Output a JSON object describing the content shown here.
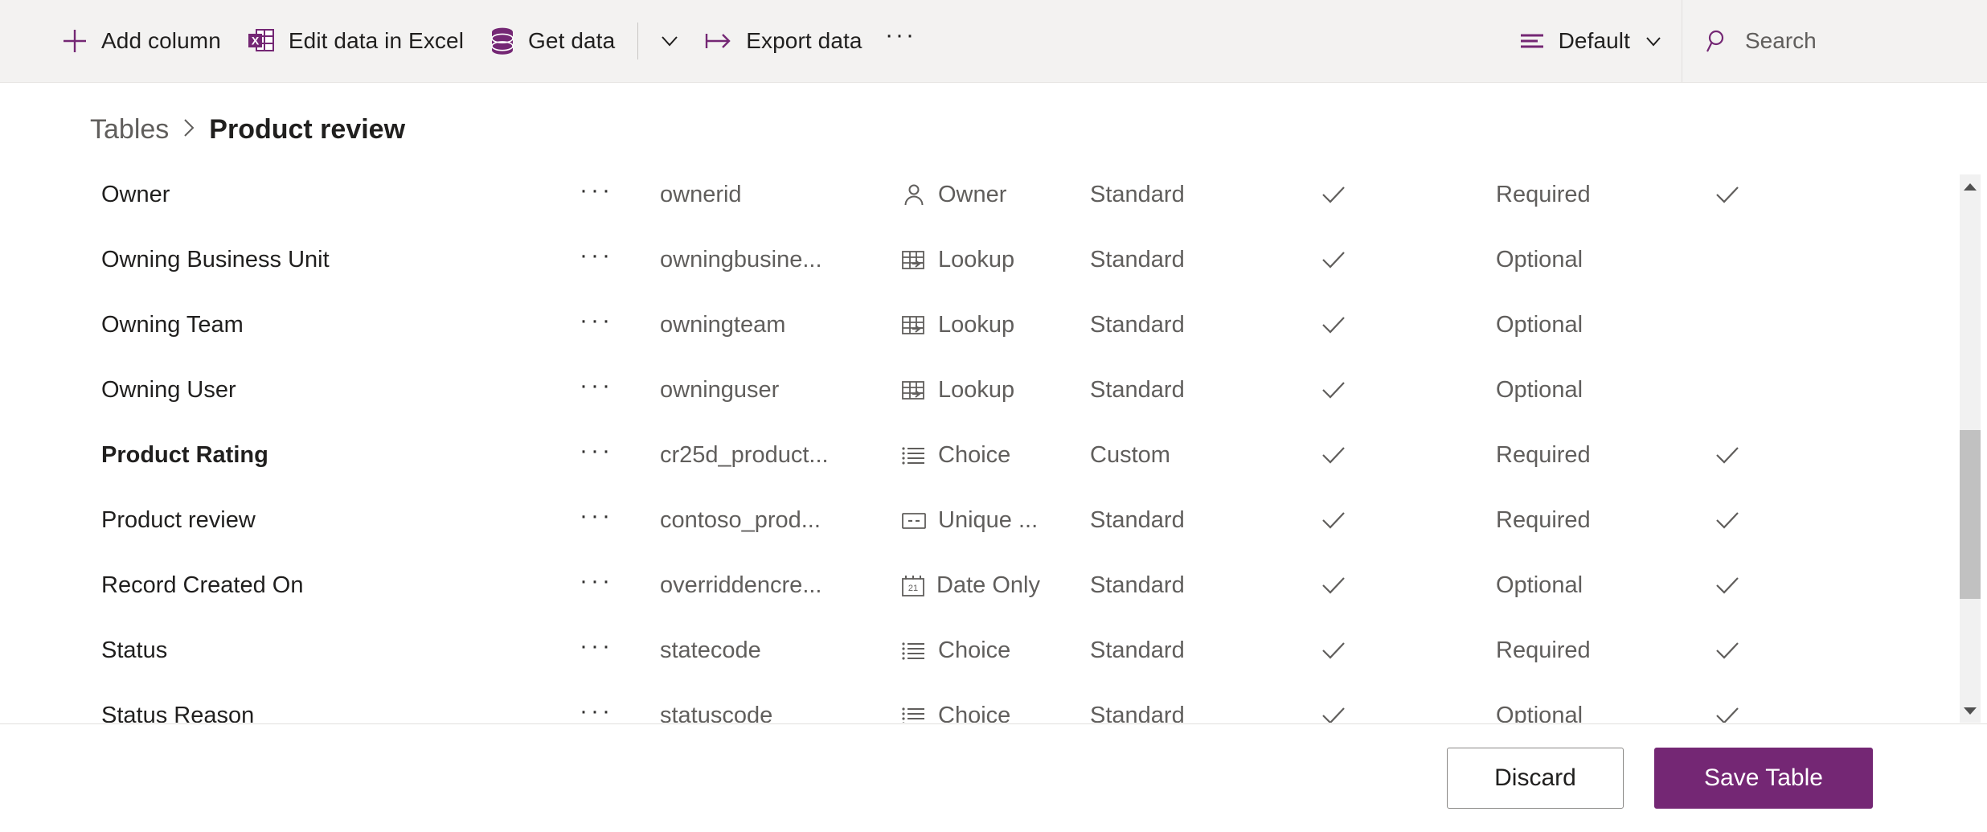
{
  "commandbar": {
    "add_column": "Add column",
    "edit_in_excel": "Edit data in Excel",
    "get_data": "Get data",
    "export_data": "Export data",
    "overflow": "···",
    "view_name": "Default",
    "search_placeholder": "Search",
    "icons": {
      "add": "plus-icon",
      "excel": "excel-icon",
      "database": "database-icon",
      "chevron": "chevron-down-icon",
      "export": "export-arrow-icon",
      "view": "view-list-icon",
      "search": "search-icon"
    },
    "accent_color": "#742774"
  },
  "breadcrumb": {
    "parent": "Tables",
    "separator": "›",
    "current": "Product review"
  },
  "grid": {
    "menu_glyph": "···",
    "check_glyph": "check-icon",
    "rows": [
      {
        "display_name": "Owner",
        "bold": false,
        "logical_name": "ownerid",
        "data_type": "Owner",
        "type_icon": "person-icon",
        "customization": "Standard",
        "searchable": true,
        "requirement": "Required",
        "last_check": true
      },
      {
        "display_name": "Owning Business Unit",
        "bold": false,
        "logical_name": "owningbusine...",
        "data_type": "Lookup",
        "type_icon": "lookup-icon",
        "customization": "Standard",
        "searchable": true,
        "requirement": "Optional",
        "last_check": false
      },
      {
        "display_name": "Owning Team",
        "bold": false,
        "logical_name": "owningteam",
        "data_type": "Lookup",
        "type_icon": "lookup-icon",
        "customization": "Standard",
        "searchable": true,
        "requirement": "Optional",
        "last_check": false
      },
      {
        "display_name": "Owning User",
        "bold": false,
        "logical_name": "owninguser",
        "data_type": "Lookup",
        "type_icon": "lookup-icon",
        "customization": "Standard",
        "searchable": true,
        "requirement": "Optional",
        "last_check": false
      },
      {
        "display_name": "Product Rating",
        "bold": true,
        "logical_name": "cr25d_product...",
        "data_type": "Choice",
        "type_icon": "choice-icon",
        "customization": "Custom",
        "searchable": true,
        "requirement": "Required",
        "last_check": true
      },
      {
        "display_name": "Product review",
        "bold": false,
        "logical_name": "contoso_prod...",
        "data_type": "Unique ...",
        "type_icon": "unique-id-icon",
        "customization": "Standard",
        "searchable": true,
        "requirement": "Required",
        "last_check": true
      },
      {
        "display_name": "Record Created On",
        "bold": false,
        "logical_name": "overriddencre...",
        "data_type": "Date Only",
        "type_icon": "calendar-icon",
        "customization": "Standard",
        "searchable": true,
        "requirement": "Optional",
        "last_check": true
      },
      {
        "display_name": "Status",
        "bold": false,
        "logical_name": "statecode",
        "data_type": "Choice",
        "type_icon": "choice-icon",
        "customization": "Standard",
        "searchable": true,
        "requirement": "Required",
        "last_check": true
      },
      {
        "display_name": "Status Reason",
        "bold": false,
        "logical_name": "statuscode",
        "data_type": "Choice",
        "type_icon": "choice-icon",
        "customization": "Standard",
        "searchable": true,
        "requirement": "Optional",
        "last_check": true
      }
    ]
  },
  "footer": {
    "discard_label": "Discard",
    "save_label": "Save Table"
  }
}
